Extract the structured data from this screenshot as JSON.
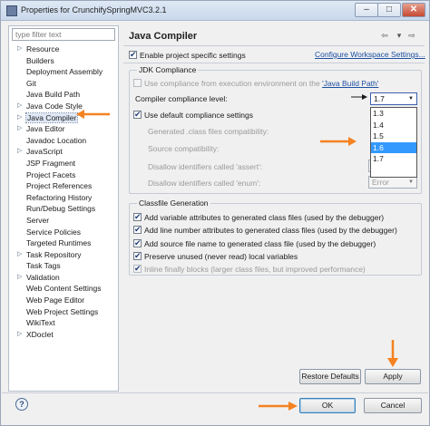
{
  "window": {
    "title": "Properties for CrunchifySpringMVC3.2.1"
  },
  "filter": {
    "placeholder": "type filter text"
  },
  "tree": {
    "items": [
      {
        "label": "Resource",
        "expandable": true
      },
      {
        "label": "Builders",
        "expandable": false
      },
      {
        "label": "Deployment Assembly",
        "expandable": false
      },
      {
        "label": "Git",
        "expandable": false
      },
      {
        "label": "Java Build Path",
        "expandable": false
      },
      {
        "label": "Java Code Style",
        "expandable": true
      },
      {
        "label": "Java Compiler",
        "expandable": true,
        "selected": true
      },
      {
        "label": "Java Editor",
        "expandable": true
      },
      {
        "label": "Javadoc Location",
        "expandable": false
      },
      {
        "label": "JavaScript",
        "expandable": true
      },
      {
        "label": "JSP Fragment",
        "expandable": false
      },
      {
        "label": "Project Facets",
        "expandable": false
      },
      {
        "label": "Project References",
        "expandable": false
      },
      {
        "label": "Refactoring History",
        "expandable": false
      },
      {
        "label": "Run/Debug Settings",
        "expandable": false
      },
      {
        "label": "Server",
        "expandable": false
      },
      {
        "label": "Service Policies",
        "expandable": false
      },
      {
        "label": "Targeted Runtimes",
        "expandable": false
      },
      {
        "label": "Task Repository",
        "expandable": true
      },
      {
        "label": "Task Tags",
        "expandable": false
      },
      {
        "label": "Validation",
        "expandable": true
      },
      {
        "label": "Web Content Settings",
        "expandable": false
      },
      {
        "label": "Web Page Editor",
        "expandable": false
      },
      {
        "label": "Web Project Settings",
        "expandable": false
      },
      {
        "label": "WikiText",
        "expandable": false
      },
      {
        "label": "XDoclet",
        "expandable": true
      }
    ]
  },
  "main": {
    "title": "Java Compiler",
    "enable_specific": "Enable project specific settings",
    "configure_link": "Configure Workspace Settings...",
    "jdk_group": "JDK Compliance",
    "use_exec_env": "Use compliance from execution environment on the ",
    "use_exec_env_link": "'Java Build Path'",
    "compliance_label": "Compiler compliance level:",
    "compliance_value": "1.7",
    "compliance_options": [
      "1.3",
      "1.4",
      "1.5",
      "1.6",
      "1.7"
    ],
    "compliance_highlight": "1.6",
    "use_default": "Use default compliance settings",
    "gen_class_compat": "Generated .class files compatibility:",
    "source_compat": "Source compatibility:",
    "disallow_assert": "Disallow identifiers called 'assert':",
    "disallow_enum": "Disallow identifiers called 'enum':",
    "error_value": "Error",
    "classfile_group": "Classfile Generation",
    "cf_vars": "Add variable attributes to generated class files (used by the debugger)",
    "cf_line": "Add line number attributes to generated class files (used by the debugger)",
    "cf_source": "Add source file name to generated class file (used by the debugger)",
    "cf_preserve": "Preserve unused (never read) local variables",
    "cf_inline": "Inline finally blocks (larger class files, but improved performance)",
    "restore_defaults": "Restore Defaults",
    "apply": "Apply"
  },
  "footer": {
    "help": "?",
    "ok": "OK",
    "cancel": "Cancel"
  },
  "colors": {
    "accent": "#3399ff",
    "annotation": "#f58220"
  }
}
